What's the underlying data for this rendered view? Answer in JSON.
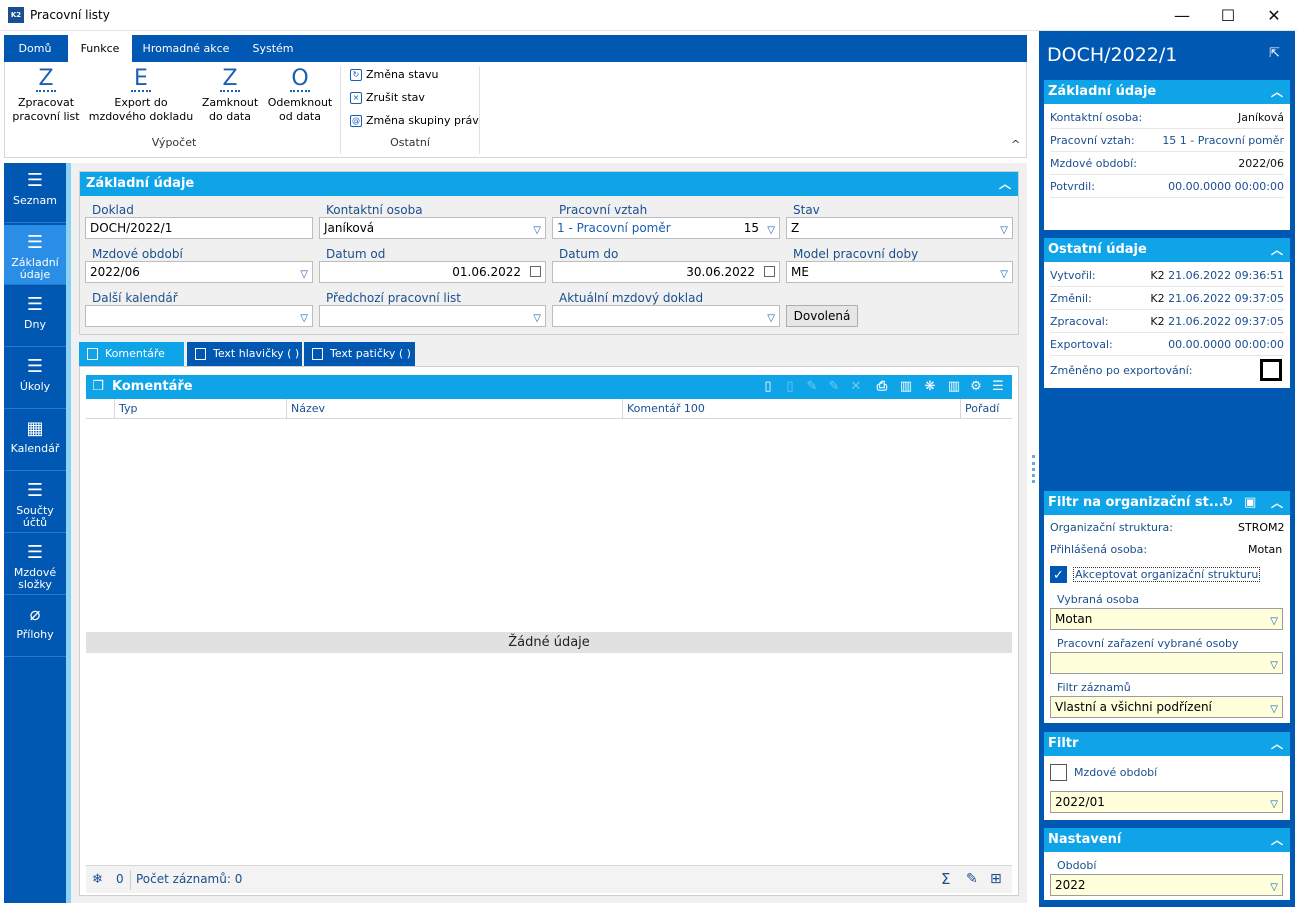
{
  "window": {
    "title": "Pracovní listy",
    "logo": "K2"
  },
  "ribbon": {
    "tabs": [
      "Domů",
      "Funkce",
      "Hromadné akce",
      "Systém"
    ],
    "active_tab": "Funkce",
    "big_buttons": [
      {
        "glyph": "Z",
        "label": "Zpracovat pracovní list"
      },
      {
        "glyph": "E",
        "label": "Export do mzdového dokladu"
      },
      {
        "glyph": "Z",
        "label": "Zamknout do data"
      },
      {
        "glyph": "O",
        "label": "Odemknout od data"
      }
    ],
    "small_buttons": [
      "Změna stavu",
      "Zrušit stav",
      "Změna skupiny práv"
    ],
    "groups": [
      "Výpočet",
      "Ostatní"
    ]
  },
  "nav": [
    {
      "label": "Seznam",
      "icon": "list-icon"
    },
    {
      "label": "Základní údaje",
      "icon": "detail-list-icon",
      "active": true
    },
    {
      "label": "Dny",
      "icon": "list-icon"
    },
    {
      "label": "Úkoly",
      "icon": "list-icon"
    },
    {
      "label": "Kalendář",
      "icon": "calendar-icon"
    },
    {
      "label": "Součty účtů",
      "icon": "list-icon"
    },
    {
      "label": "Mzdové složky",
      "icon": "list-icon"
    },
    {
      "label": "Přílohy",
      "icon": "paperclip-icon"
    }
  ],
  "basic": {
    "title": "Základní údaje",
    "doklad_label": "Doklad",
    "doklad": "DOCH/2022/1",
    "kontakt_label": "Kontaktní osoba",
    "kontakt": "Janíková",
    "vztah_label": "Pracovní vztah",
    "vztah": "1 - Pracovní poměr",
    "vztah_num": "15",
    "stav_label": "Stav",
    "stav": "Z",
    "obdobi_label": "Mzdové období",
    "obdobi": "2022/06",
    "od_label": "Datum od",
    "od": "01.06.2022",
    "do_label": "Datum do",
    "do": "30.06.2022",
    "model_label": "Model pracovní doby",
    "model": "ME",
    "kalendar_label": "Další kalendář",
    "kalendar": "",
    "predchozi_label": "Předchozí pracovní list",
    "predchozi": "",
    "aktualni_label": "Aktuální mzdový doklad",
    "aktualni": "",
    "dovolena": "Dovolená"
  },
  "content_tabs": [
    "Komentáře (0)",
    "Text hlavičky ( )",
    "Text patičky ( )"
  ],
  "grid": {
    "title": "Komentáře",
    "columns": [
      "Typ",
      "Název",
      "Komentář 100",
      "Pořadí"
    ],
    "empty": "Žádné údaje",
    "footer_count": "0",
    "footer_records": "Počet záznamů: 0"
  },
  "right": {
    "title": "DOCH/2022/1",
    "basic": {
      "title": "Základní údaje",
      "rows": [
        {
          "k": "Kontaktní osoba:",
          "v": "Janíková"
        },
        {
          "k": "Pracovní vztah:",
          "v": "15 1 - Pracovní poměr"
        },
        {
          "k": "Mzdové období:",
          "v": "2022/06"
        },
        {
          "k": "Potvrdil:",
          "v": "00.00.0000 00:00:00"
        }
      ]
    },
    "other": {
      "title": "Ostatní údaje",
      "rows": [
        {
          "k": "Vytvořil:",
          "u": "K2",
          "v": "21.06.2022 09:36:51"
        },
        {
          "k": "Změnil:",
          "u": "K2",
          "v": "21.06.2022 09:37:05"
        },
        {
          "k": "Zpracoval:",
          "u": "K2",
          "v": "21.06.2022 09:37:05"
        },
        {
          "k": "Exportoval:",
          "u": "",
          "v": "00.00.0000 00:00:00"
        }
      ],
      "changed_label": "Změněno po exportování:"
    },
    "org": {
      "title": "Filtr na organizační st...",
      "struct_label": "Organizační struktura:",
      "struct": "STROM2",
      "user_label": "Přihlášená osoba:",
      "user": "Motan",
      "accept_label": "Akceptovat organizační strukturu",
      "person_label": "Vybraná osoba",
      "person": "Motan",
      "assignment_label": "Pracovní zařazení vybrané osoby",
      "assignment": "",
      "records_label": "Filtr záznamů",
      "records": "Vlastní a všichni podřízení"
    },
    "filter": {
      "title": "Filtr",
      "period_label": "Mzdové období",
      "period": "2022/01"
    },
    "settings": {
      "title": "Nastavení",
      "period_label": "Období",
      "period": "2022"
    }
  }
}
